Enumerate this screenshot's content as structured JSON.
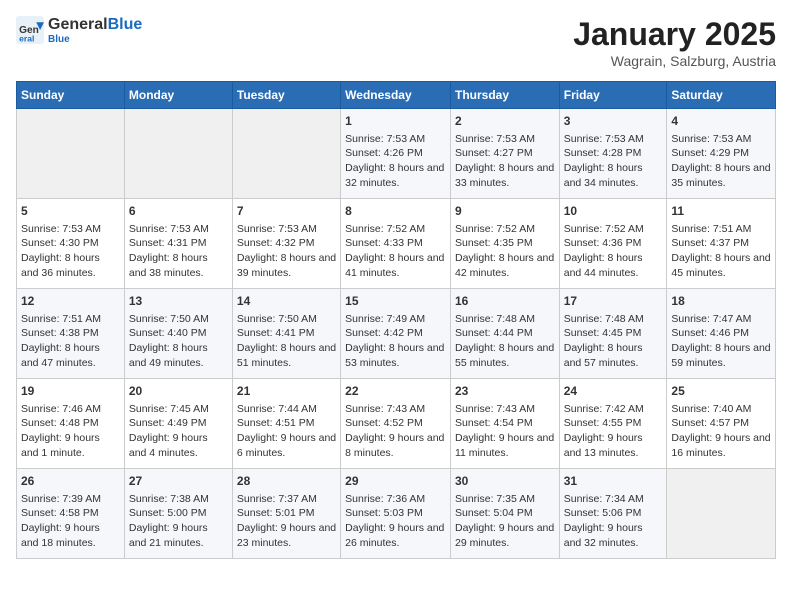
{
  "header": {
    "logo_general": "General",
    "logo_blue": "Blue",
    "month": "January 2025",
    "location": "Wagrain, Salzburg, Austria"
  },
  "days_of_week": [
    "Sunday",
    "Monday",
    "Tuesday",
    "Wednesday",
    "Thursday",
    "Friday",
    "Saturday"
  ],
  "weeks": [
    [
      {
        "day": "",
        "empty": true
      },
      {
        "day": "",
        "empty": true
      },
      {
        "day": "",
        "empty": true
      },
      {
        "day": "1",
        "sunrise": "7:53 AM",
        "sunset": "4:26 PM",
        "daylight": "8 hours and 32 minutes."
      },
      {
        "day": "2",
        "sunrise": "7:53 AM",
        "sunset": "4:27 PM",
        "daylight": "8 hours and 33 minutes."
      },
      {
        "day": "3",
        "sunrise": "7:53 AM",
        "sunset": "4:28 PM",
        "daylight": "8 hours and 34 minutes."
      },
      {
        "day": "4",
        "sunrise": "7:53 AM",
        "sunset": "4:29 PM",
        "daylight": "8 hours and 35 minutes."
      }
    ],
    [
      {
        "day": "5",
        "sunrise": "7:53 AM",
        "sunset": "4:30 PM",
        "daylight": "8 hours and 36 minutes."
      },
      {
        "day": "6",
        "sunrise": "7:53 AM",
        "sunset": "4:31 PM",
        "daylight": "8 hours and 38 minutes."
      },
      {
        "day": "7",
        "sunrise": "7:53 AM",
        "sunset": "4:32 PM",
        "daylight": "8 hours and 39 minutes."
      },
      {
        "day": "8",
        "sunrise": "7:52 AM",
        "sunset": "4:33 PM",
        "daylight": "8 hours and 41 minutes."
      },
      {
        "day": "9",
        "sunrise": "7:52 AM",
        "sunset": "4:35 PM",
        "daylight": "8 hours and 42 minutes."
      },
      {
        "day": "10",
        "sunrise": "7:52 AM",
        "sunset": "4:36 PM",
        "daylight": "8 hours and 44 minutes."
      },
      {
        "day": "11",
        "sunrise": "7:51 AM",
        "sunset": "4:37 PM",
        "daylight": "8 hours and 45 minutes."
      }
    ],
    [
      {
        "day": "12",
        "sunrise": "7:51 AM",
        "sunset": "4:38 PM",
        "daylight": "8 hours and 47 minutes."
      },
      {
        "day": "13",
        "sunrise": "7:50 AM",
        "sunset": "4:40 PM",
        "daylight": "8 hours and 49 minutes."
      },
      {
        "day": "14",
        "sunrise": "7:50 AM",
        "sunset": "4:41 PM",
        "daylight": "8 hours and 51 minutes."
      },
      {
        "day": "15",
        "sunrise": "7:49 AM",
        "sunset": "4:42 PM",
        "daylight": "8 hours and 53 minutes."
      },
      {
        "day": "16",
        "sunrise": "7:48 AM",
        "sunset": "4:44 PM",
        "daylight": "8 hours and 55 minutes."
      },
      {
        "day": "17",
        "sunrise": "7:48 AM",
        "sunset": "4:45 PM",
        "daylight": "8 hours and 57 minutes."
      },
      {
        "day": "18",
        "sunrise": "7:47 AM",
        "sunset": "4:46 PM",
        "daylight": "8 hours and 59 minutes."
      }
    ],
    [
      {
        "day": "19",
        "sunrise": "7:46 AM",
        "sunset": "4:48 PM",
        "daylight": "9 hours and 1 minute."
      },
      {
        "day": "20",
        "sunrise": "7:45 AM",
        "sunset": "4:49 PM",
        "daylight": "9 hours and 4 minutes."
      },
      {
        "day": "21",
        "sunrise": "7:44 AM",
        "sunset": "4:51 PM",
        "daylight": "9 hours and 6 minutes."
      },
      {
        "day": "22",
        "sunrise": "7:43 AM",
        "sunset": "4:52 PM",
        "daylight": "9 hours and 8 minutes."
      },
      {
        "day": "23",
        "sunrise": "7:43 AM",
        "sunset": "4:54 PM",
        "daylight": "9 hours and 11 minutes."
      },
      {
        "day": "24",
        "sunrise": "7:42 AM",
        "sunset": "4:55 PM",
        "daylight": "9 hours and 13 minutes."
      },
      {
        "day": "25",
        "sunrise": "7:40 AM",
        "sunset": "4:57 PM",
        "daylight": "9 hours and 16 minutes."
      }
    ],
    [
      {
        "day": "26",
        "sunrise": "7:39 AM",
        "sunset": "4:58 PM",
        "daylight": "9 hours and 18 minutes."
      },
      {
        "day": "27",
        "sunrise": "7:38 AM",
        "sunset": "5:00 PM",
        "daylight": "9 hours and 21 minutes."
      },
      {
        "day": "28",
        "sunrise": "7:37 AM",
        "sunset": "5:01 PM",
        "daylight": "9 hours and 23 minutes."
      },
      {
        "day": "29",
        "sunrise": "7:36 AM",
        "sunset": "5:03 PM",
        "daylight": "9 hours and 26 minutes."
      },
      {
        "day": "30",
        "sunrise": "7:35 AM",
        "sunset": "5:04 PM",
        "daylight": "9 hours and 29 minutes."
      },
      {
        "day": "31",
        "sunrise": "7:34 AM",
        "sunset": "5:06 PM",
        "daylight": "9 hours and 32 minutes."
      },
      {
        "day": "",
        "empty": true
      }
    ]
  ],
  "labels": {
    "sunrise": "Sunrise:",
    "sunset": "Sunset:",
    "daylight": "Daylight:"
  }
}
